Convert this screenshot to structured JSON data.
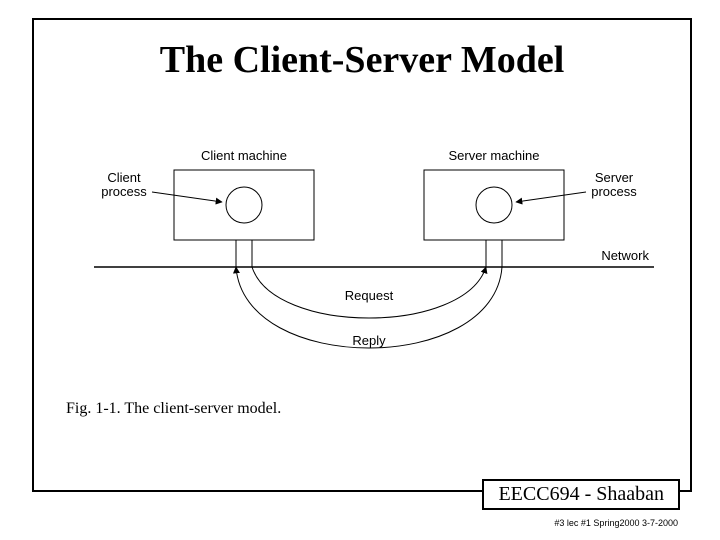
{
  "title": "The Client-Server Model",
  "diagram": {
    "client_machine": "Client machine",
    "server_machine": "Server machine",
    "client_process": "Client\nprocess",
    "server_process": "Server\nprocess",
    "network": "Network",
    "request": "Request",
    "reply": "Reply"
  },
  "caption": "Fig. 1-1. The client-server model.",
  "footer": "EECC694 - Shaaban",
  "smallprint": "#3 lec #1   Spring2000  3-7-2000"
}
